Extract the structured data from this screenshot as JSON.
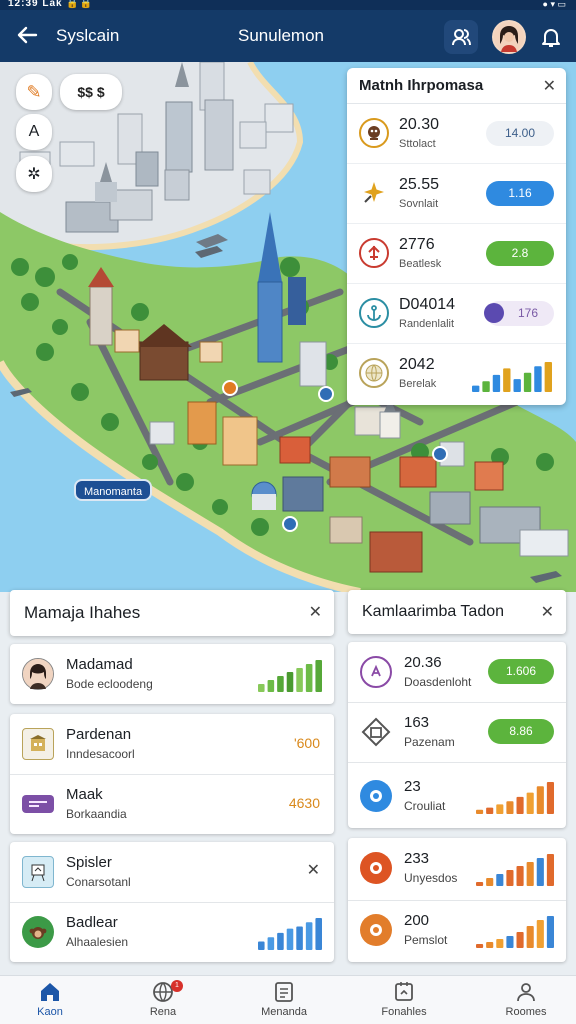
{
  "status": {
    "left": "12:39 Lak 🔒🔒",
    "right": "● ▾ ▭"
  },
  "appbar": {
    "back_icon": "arrow-left-icon",
    "breadcrumb": "Syslcain",
    "title": "Sunulemon",
    "actions": [
      "people-icon",
      "user-avatar",
      "bell-icon"
    ]
  },
  "map": {
    "tools": {
      "t1": "✎",
      "t2": "$$ $",
      "t3": "A",
      "t4": "✲"
    },
    "district_label": "Manomanta"
  },
  "metrics": {
    "title": "Matnh Ihrpomasa",
    "rows": [
      {
        "value": "20.30",
        "sub": "Sttolact",
        "badge": "14.00",
        "icon": "mascot-icon",
        "icon_color": "#d99a1d",
        "badge_bg": "#eef1f5",
        "badge_fg": "#3d5f8a"
      },
      {
        "value": "25.55",
        "sub": "Sovnlait",
        "badge": "1.16",
        "icon": "sparkle-icon",
        "icon_color": "#e0a21e",
        "badge_bg": "#2f8ae0",
        "badge_fg": "#ffffff"
      },
      {
        "value": "2776",
        "sub": "Beatlesk",
        "badge": "2.8",
        "icon": "chart-icon",
        "icon_color": "#c93b30",
        "badge_bg": "#5cb43d",
        "badge_fg": "#ffffff"
      },
      {
        "value": "D04014",
        "sub": "Randenlalit",
        "badge": "176",
        "icon": "anchor-icon",
        "icon_color": "#2b8ea3",
        "badge_bg": "#efe9f6",
        "badge_fg": "#7a5aa6"
      },
      {
        "value": "2042",
        "sub": "Berelak",
        "badge": "",
        "icon": "globe-icon",
        "icon_color": "#b9a35a"
      }
    ],
    "row5_bars": [
      6,
      10,
      16,
      22,
      12,
      18,
      24,
      28
    ]
  },
  "left_panel": {
    "title": "Mamaja Ihahes",
    "items": [
      {
        "value": "Madamad",
        "sub": "Bode ecloodeng",
        "icon": "person-avatar",
        "bars": [
          8,
          12,
          16,
          20,
          24,
          28,
          32
        ]
      },
      {
        "value": "Pardenan",
        "sub": "Inndesacoorl",
        "icon": "building-icon",
        "num": "'600"
      },
      {
        "value": "Maak",
        "sub": "Borkaandia",
        "icon": "card-icon",
        "num": "4630"
      }
    ],
    "spisler": {
      "title": "Spisler",
      "sub": "Conarsotanl",
      "item": {
        "value": "Badlear",
        "sub": "Alhaalesien",
        "icon": "monkey-icon",
        "bars": [
          8,
          12,
          16,
          20,
          22,
          26,
          30
        ]
      }
    }
  },
  "right_panel": {
    "title": "Kamlaarimba Tadon",
    "items": [
      {
        "value": "20.36",
        "sub": "Doasdenloht",
        "icon": "letter-icon",
        "pill": "1.606",
        "icon_color": "#8a4aa6"
      },
      {
        "value": "163",
        "sub": "Pazenam",
        "icon": "gem-icon",
        "pill": "8.86",
        "icon_color": "#555555"
      },
      {
        "value": "23",
        "sub": "Crouliat",
        "icon": "target-icon",
        "icon_color": "#2f8ae0",
        "bars": [
          4,
          6,
          9,
          12,
          16,
          20,
          26,
          30
        ]
      },
      {
        "value": "233",
        "sub": "Unyesdos",
        "icon": "ring-icon",
        "icon_color": "#dd5423",
        "bars": [
          4,
          8,
          12,
          16,
          20,
          24,
          28,
          32
        ]
      },
      {
        "value": "200",
        "sub": "Pemslot",
        "icon": "ring2-icon",
        "icon_color": "#e27d2b",
        "bars": [
          4,
          6,
          9,
          12,
          16,
          22,
          28,
          32
        ]
      }
    ]
  },
  "nav": [
    {
      "label": "Kaon",
      "icon": "home-icon",
      "active": true
    },
    {
      "label": "Rena",
      "icon": "globe-icon",
      "badge": "1"
    },
    {
      "label": "Menanda",
      "icon": "document-icon"
    },
    {
      "label": "Fonahles",
      "icon": "calendar-icon"
    },
    {
      "label": "Roomes",
      "icon": "person-icon"
    }
  ],
  "colors": {
    "appbar": "#143a68",
    "water": "#8ecff0",
    "land": "#8dc866",
    "accent": "#1c56a8"
  }
}
